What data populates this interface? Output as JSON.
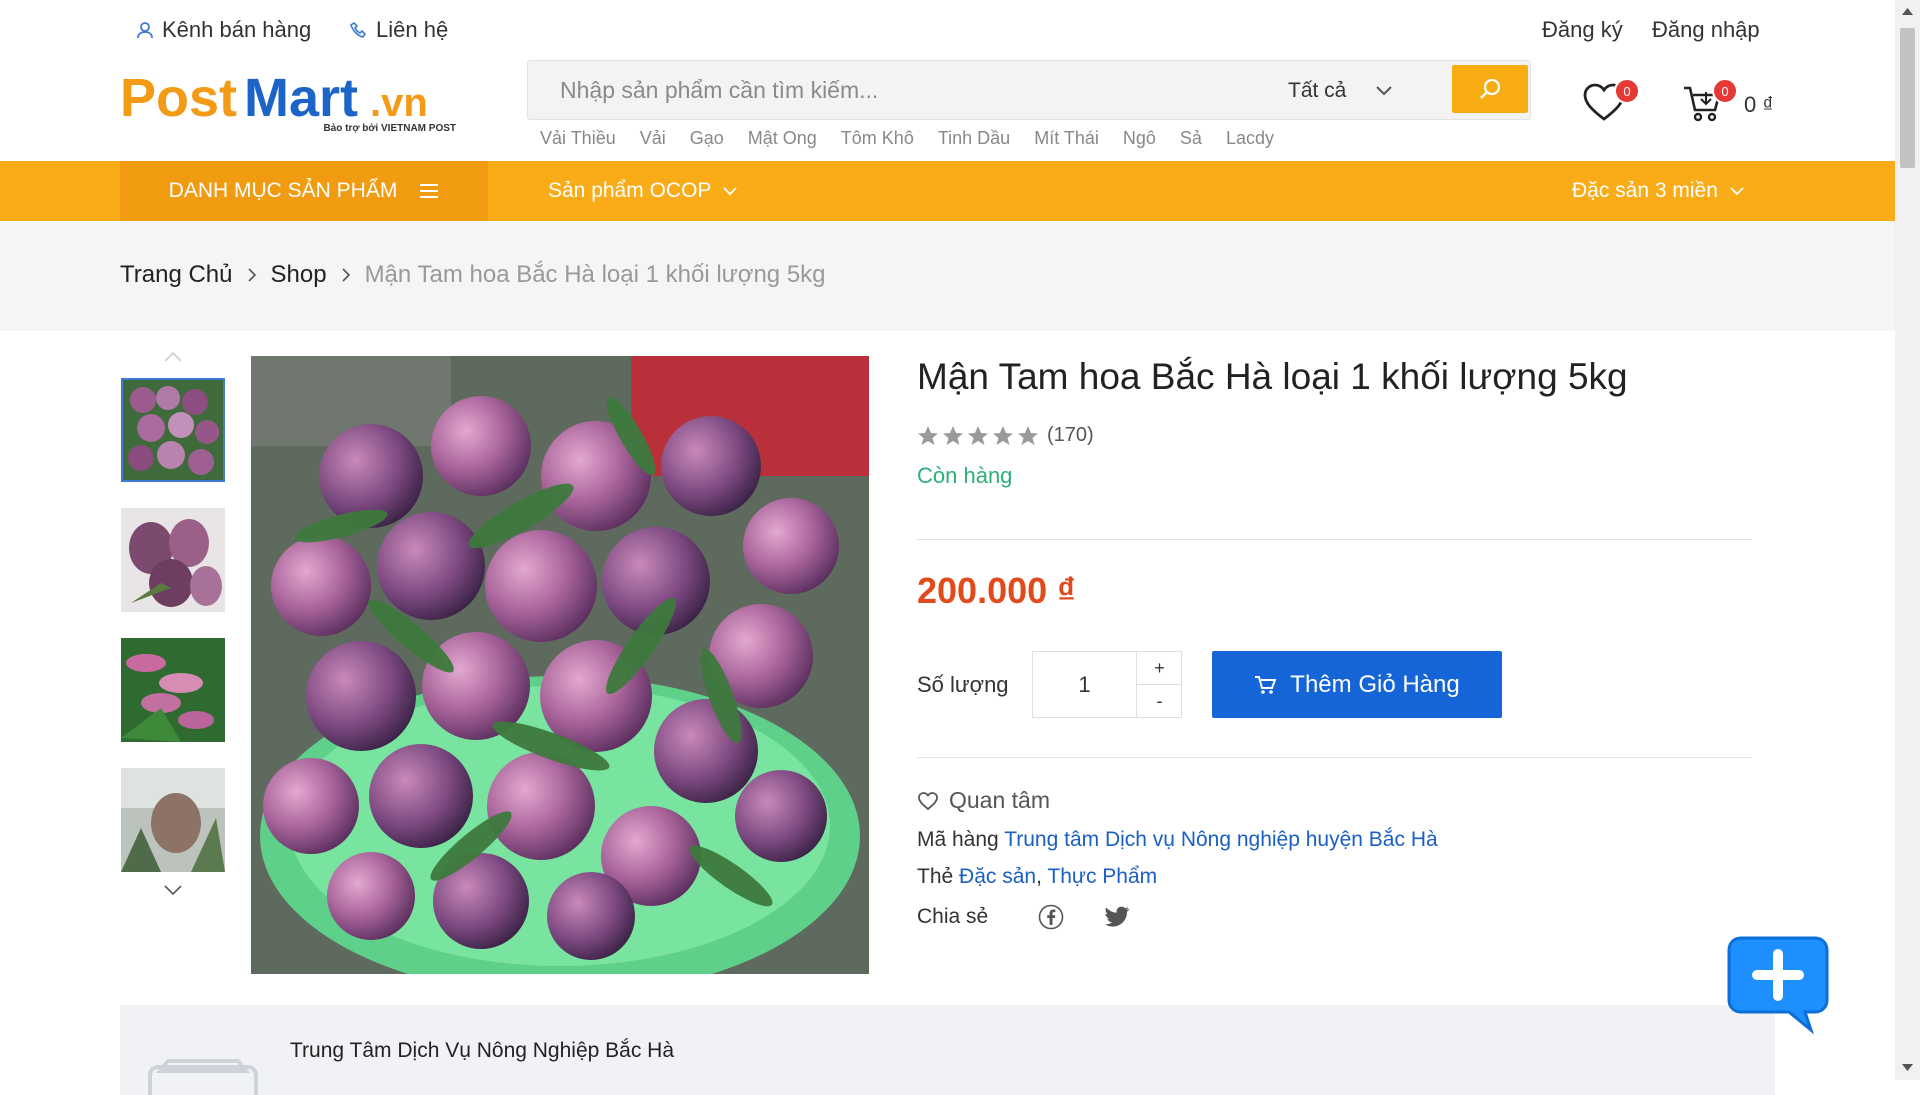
{
  "header": {
    "seller_channel": "Kênh bán hàng",
    "contact": "Liên hệ",
    "register": "Đăng ký",
    "login": "Đăng nhập",
    "logo_text": "PostMart.vn",
    "logo_sub": "Bảo trợ bởi VIETNAM POST",
    "search_placeholder": "Nhập sản phẩm cần tìm kiếm...",
    "search_category": "Tất cả",
    "wishlist_count": "0",
    "cart_count": "0",
    "cart_total": "0 ₫",
    "suggestions": [
      "Vải Thiều",
      "Vải",
      "Gạo",
      "Mật Ong",
      "Tôm Khô",
      "Tinh Dầu",
      "Mít Thái",
      "Ngô",
      "Sả",
      "Lacdy"
    ]
  },
  "nav": {
    "categories": "DANH MỤC SẢN PHẨM",
    "ocop": "Sản phẩm OCOP",
    "regions": "Đặc sản 3 miền"
  },
  "breadcrumb": {
    "home": "Trang Chủ",
    "shop": "Shop",
    "current": "Mận Tam hoa Bắc Hà loại 1 khối lượng 5kg"
  },
  "product": {
    "title": "Mận Tam hoa Bắc Hà loại 1 khối lượng 5kg",
    "rating_stars": 5,
    "review_count": "(170)",
    "stock": "Còn hàng",
    "price": "200.000 ₫",
    "qty_label": "Số lượng",
    "qty_value": "1",
    "qty_plus": "+",
    "qty_minus": "-",
    "add_to_cart": "Thêm Giỏ Hàng",
    "wishlist": "Quan tâm",
    "sku_label": "Mã hàng",
    "sku_value": "Trung tâm Dịch vụ Nông nghiệp huyện Bắc Hà",
    "tags_label": "Thẻ",
    "tag1": "Đặc sản",
    "tag_sep": ",",
    "tag2": "Thực Phẩm",
    "share_label": "Chia sẻ"
  },
  "seller": {
    "name": "Trung Tâm Dịch Vụ Nông Nghiệp Bắc Hà"
  },
  "colors": {
    "accent_orange": "#f9ac18",
    "price_red": "#e14a1b",
    "stock_green": "#2db079",
    "cart_blue": "#1565d8",
    "link_blue": "#1a5fc4"
  }
}
